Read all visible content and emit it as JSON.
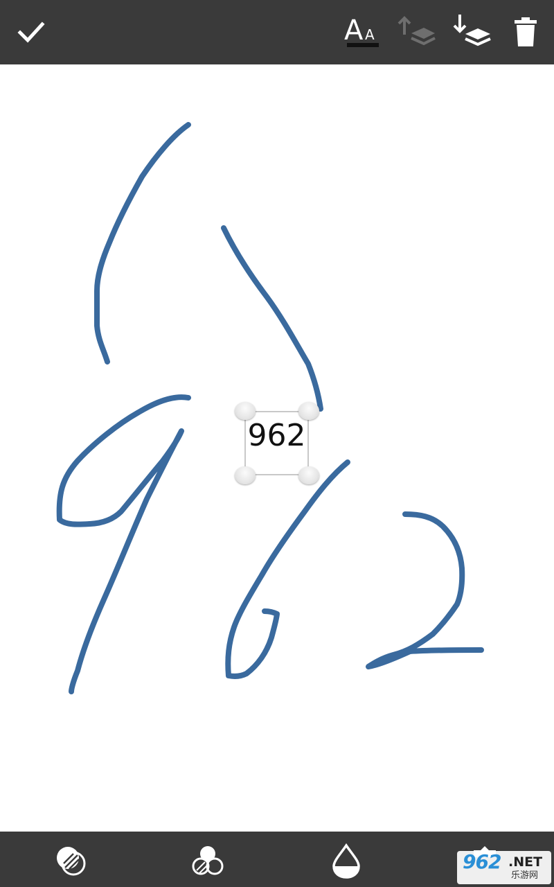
{
  "toolbar": {
    "done_icon": "check-icon",
    "text_style_icon": "text-size-icon",
    "bring_forward_icon": "layer-up-icon",
    "send_backward_icon": "layer-down-icon",
    "delete_icon": "trash-icon"
  },
  "canvas": {
    "ink_color": "#3a6a9e",
    "text_box": {
      "text": "962"
    }
  },
  "bottom_toolbar": {
    "items": [
      {
        "icon": "blend-mode-icon"
      },
      {
        "icon": "color-mix-icon"
      },
      {
        "icon": "opacity-drop-icon"
      },
      {
        "icon": "settings-icon"
      }
    ]
  },
  "watermark": {
    "main": "962",
    "suffix": ".NET",
    "sub": "乐游网"
  }
}
